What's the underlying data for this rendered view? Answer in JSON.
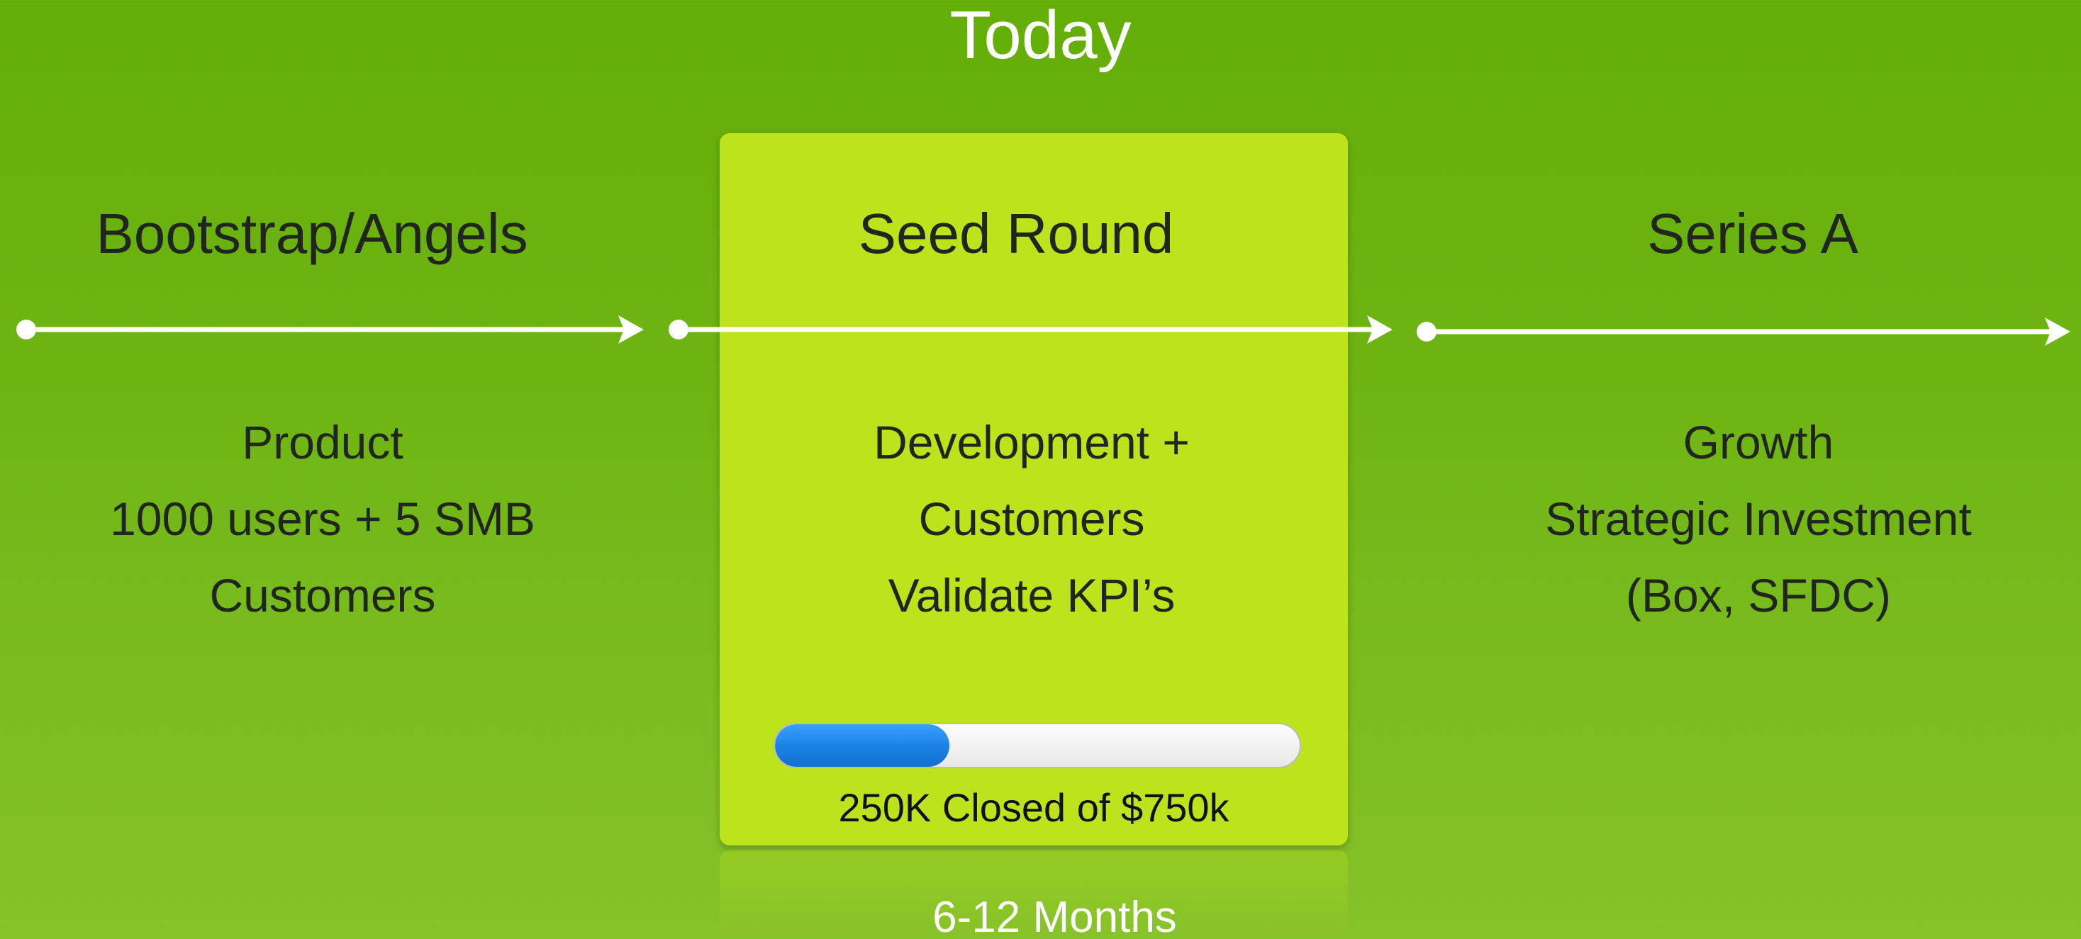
{
  "header": {
    "label": "Today"
  },
  "stages": [
    {
      "title": "Bootstrap/Angels",
      "lines": [
        "Product",
        "1000 users + 5 SMB",
        "Customers"
      ]
    },
    {
      "title": "Seed Round",
      "lines": [
        "Development +",
        "Customers",
        "Validate KPI’s"
      ]
    },
    {
      "title": "Series A",
      "lines": [
        "Growth",
        "Strategic Investment",
        "(Box, SFDC)"
      ]
    }
  ],
  "progress": {
    "fraction": 0.333,
    "label": "250K Closed of $750k"
  },
  "duration": "6-12 Months",
  "colors": {
    "background": "#6fb614",
    "highlight_card": "#bce31c",
    "progress_fill": "#1a84e6",
    "timeline": "#ffffff"
  }
}
